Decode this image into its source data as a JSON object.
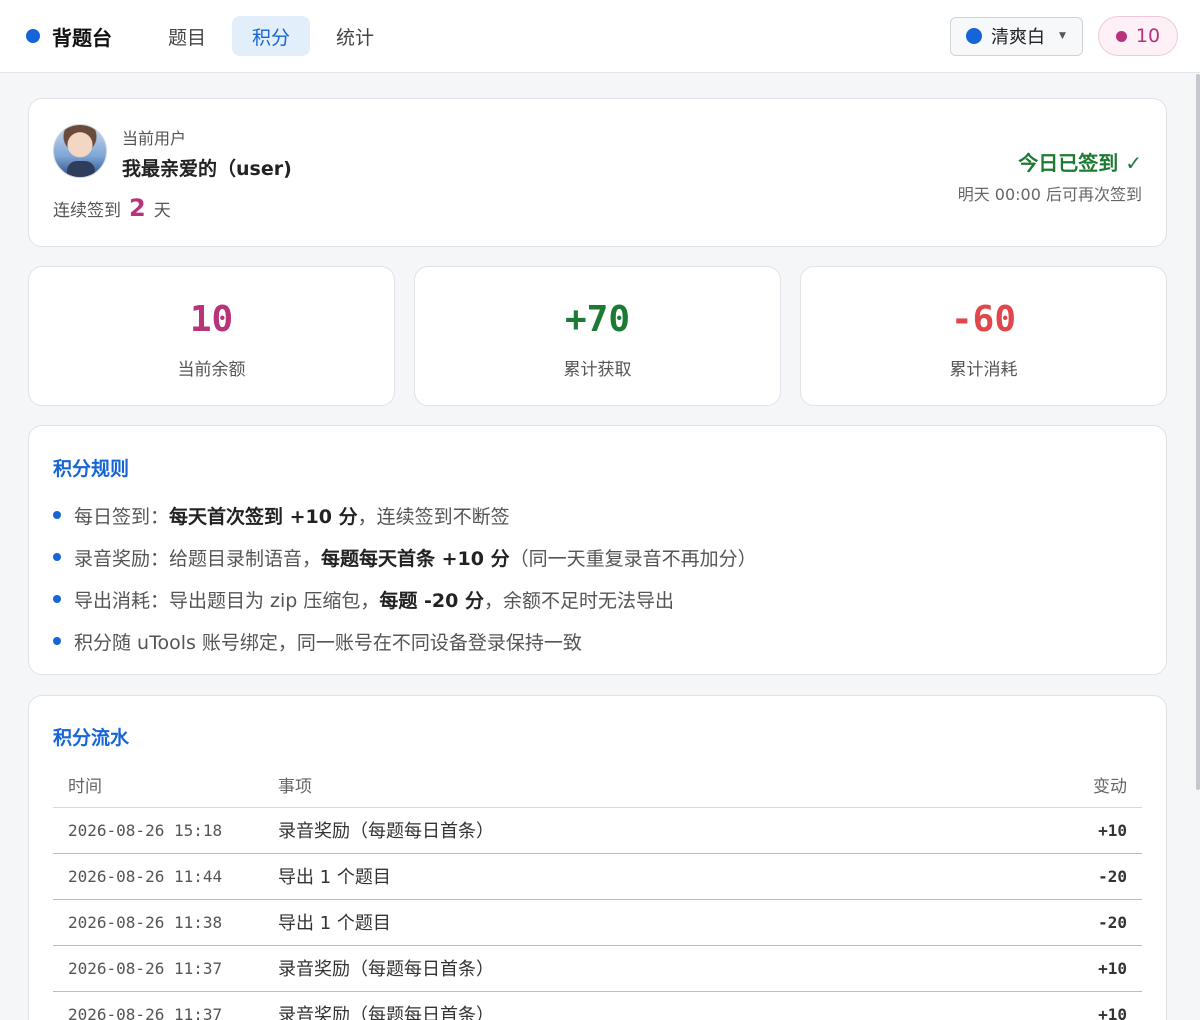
{
  "app": {
    "name": "背题台"
  },
  "nav": {
    "tabs": [
      "题目",
      "积分",
      "统计"
    ],
    "active": "积分"
  },
  "theme": {
    "label": "清爽白",
    "accent": "#1565d8"
  },
  "points_badge": {
    "value": "10",
    "color": "#b8337a"
  },
  "user": {
    "caption": "当前用户",
    "name": "我最亲爱的（user)",
    "streak_prefix": "连续签到",
    "streak_days": "2",
    "streak_suffix": "天",
    "signin_status": "今日已签到 ✓",
    "signin_next": "明天 00:00 后可再次签到"
  },
  "stats": {
    "balance": {
      "value": "10",
      "label": "当前余额",
      "color": "#b8337a"
    },
    "earned": {
      "value": "+70",
      "label": "累计获取",
      "color": "#1d7a33"
    },
    "spent": {
      "value": "-60",
      "label": "累计消耗",
      "color": "#e0474b"
    }
  },
  "rules": {
    "title": "积分规则",
    "items": [
      {
        "pre": "每日签到：",
        "bold": "每天首次签到 +10 分",
        "post": "，连续签到不断签"
      },
      {
        "pre": "录音奖励：给题目录制语音，",
        "bold": "每题每天首条 +10 分",
        "post": "（同一天重复录音不再加分）"
      },
      {
        "pre": "导出消耗：导出题目为 zip 压缩包，",
        "bold": "每题 -20 分",
        "post": "，余额不足时无法导出"
      },
      {
        "pre": "积分随 uTools 账号绑定，同一账号在不同设备登录保持一致",
        "bold": "",
        "post": ""
      }
    ]
  },
  "ledger": {
    "title": "积分流水",
    "columns": [
      "时间",
      "事项",
      "变动"
    ],
    "rows": [
      {
        "time": "2026-08-26 15:18",
        "item": "录音奖励（每题每日首条）",
        "change": "+10"
      },
      {
        "time": "2026-08-26 11:44",
        "item": "导出 1 个题目",
        "change": "-20"
      },
      {
        "time": "2026-08-26 11:38",
        "item": "导出 1 个题目",
        "change": "-20"
      },
      {
        "time": "2026-08-26 11:37",
        "item": "录音奖励（每题每日首条）",
        "change": "+10"
      },
      {
        "time": "2026-08-26 11:37",
        "item": "录音奖励（每题每日首条）",
        "change": "+10"
      }
    ]
  }
}
